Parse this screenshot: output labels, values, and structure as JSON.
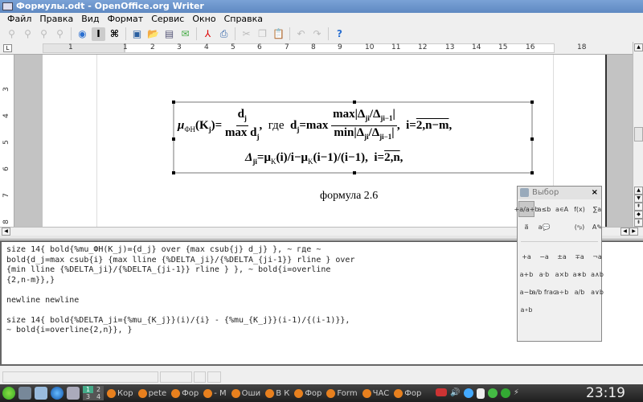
{
  "window": {
    "title": "Формулы.odt - OpenOffice.org Writer"
  },
  "menu": [
    "Файл",
    "Правка",
    "Вид",
    "Формат",
    "Сервис",
    "Окно",
    "Справка"
  ],
  "ruler": {
    "h_numbers": [
      "1",
      "1",
      "2",
      "3",
      "4",
      "5",
      "6",
      "7",
      "8",
      "9",
      "10",
      "11",
      "12",
      "13",
      "14",
      "15",
      "16",
      "18"
    ],
    "v_numbers": [
      "3",
      "4",
      "5",
      "6",
      "7",
      "8"
    ]
  },
  "formula": {
    "mu": "μ",
    "fh": "ФН",
    "kj": "(K",
    "j": "j",
    "eq": ")=",
    "dj": "d",
    "maxdj": "max d",
    "where": "где",
    "dj_eq": "=max",
    "i": "i",
    "num": "max|Δ",
    "num2": "/Δ",
    "ji": "ji",
    "ji1": "ji−1",
    "den": "min|Δ",
    "bar": "|",
    "range1_i": "i=",
    "range1": "2,n−m",
    "line2_start": "Δ",
    "line2_eq": "=μ",
    "line2_a": "(i)/i−μ",
    "line2_b": "(i−1)/(i−1),",
    "range2": "2,n",
    "kj_sub": "K"
  },
  "caption": "формула 2.6",
  "command_text": "size 14{ bold{%mu_ФН(K_j)={d_j} over {max csub{j} d_j} }, ~ где ~\nbold{d_j=max csub{i} {max lline {%DELTA_ji}/{%DELTA_{ji-1}} rline } over\n{min lline {%DELTA_ji}/{%DELTA_{ji-1}} rline } }, ~ bold{i=overline\n{2,n-m}},}\n\nnewline newline\n\nsize 14{ bold{%DELTA_ji={%mu_{K_j}}(i)/{i} - {%mu_{K_j}}(i-1)/{(i-1)}},\n~ bold{i=overline{2,n}}, }",
  "palette": {
    "title": "Выбор",
    "close": "×",
    "categories": [
      "+a/a+b",
      "a≤b",
      "a∊A",
      "f(x)",
      "∑a",
      "a⃗",
      "a💬",
      "",
      "(ᵃᵦ)",
      "A✎"
    ],
    "operators": [
      "+a",
      "−a",
      "±a",
      "∓a",
      "¬a",
      "a+b",
      "a·b",
      "a×b",
      "a∗b",
      "a∧b",
      "a−b",
      "a/b frac",
      "a÷b",
      "a/b",
      "a∨b",
      "a∘b"
    ]
  },
  "taskbar": {
    "tasks": [
      "Кор",
      "pete",
      "Фор",
      "- M",
      "Оши",
      "В К",
      "Фор",
      "Form",
      "ЧАС",
      "Фор"
    ],
    "workspaces": [
      "1",
      "2",
      "3",
      "4"
    ],
    "clock": "23:19"
  }
}
